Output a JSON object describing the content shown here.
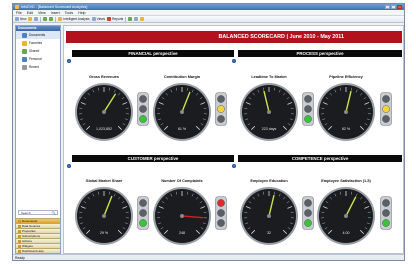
{
  "window": {
    "title": "InfoDVD - [Balanced Scorecard Analytics]"
  },
  "menu": [
    "File",
    "Edit",
    "View",
    "Insert",
    "Tools",
    "Help"
  ],
  "toolbar": {
    "new_label": "New",
    "intelligent_analysis_label": "Intelligent Analysis",
    "views_label": "Views",
    "reports_label": "Reports"
  },
  "sidebar": {
    "header": "Documents",
    "items": [
      {
        "label": "Documents",
        "icon": "folder-icon",
        "color": "#4f81bd"
      },
      {
        "label": "Favorites",
        "icon": "star-icon",
        "color": "#e8b43a"
      },
      {
        "label": "Shared",
        "icon": "people-icon",
        "color": "#6aa84f"
      },
      {
        "label": "Personal",
        "icon": "person-icon",
        "color": "#4f81bd"
      },
      {
        "label": "Recent",
        "icon": "clock-icon",
        "color": "#999999"
      }
    ],
    "search_placeholder": "Search",
    "sections": [
      "Documents",
      "Data Sources",
      "Properties",
      "Subscriptions",
      "Actions",
      "Widgets",
      "Dashboard Help"
    ]
  },
  "dashboard": {
    "title": "BALANCED SCORECARD | June 2010 - May 2011",
    "sections": [
      "FINANCIAL perspective",
      "PROCESS perspective",
      "CUSTOMER perspective",
      "COMPETENCE perspective"
    ],
    "kpis": [
      {
        "label": "Gross Revenues",
        "value_text": "1,023,852",
        "level": 0.62,
        "light": "green"
      },
      {
        "label": "Contribution Margin",
        "value_text": "61 %",
        "level": 0.58,
        "light": "yellow"
      },
      {
        "label": "Leadtime To Market",
        "value_text": "223 days",
        "level": 0.45,
        "light": "green"
      },
      {
        "label": "Pipeline Efficiency",
        "value_text": "82 %",
        "level": 0.55,
        "light": "yellow"
      },
      {
        "label": "Global Market Share",
        "value_text": "29 %",
        "level": 0.58,
        "light": "green"
      },
      {
        "label": "Number Of Complaints",
        "value_text": "248",
        "level": 0.85,
        "light": "red"
      },
      {
        "label": "Employee Education",
        "value_text": "32",
        "level": 0.55,
        "light": "green"
      },
      {
        "label": "Employee Satisfaction (1-5)",
        "value_text": "4.00",
        "level": 0.6,
        "light": "green"
      }
    ]
  },
  "colors": {
    "banner": "#b3121c",
    "section_bar": "#0a0a0a",
    "needle": "#cfe24a",
    "needle_alert": "#cc2222"
  },
  "status": {
    "text": "Ready"
  }
}
